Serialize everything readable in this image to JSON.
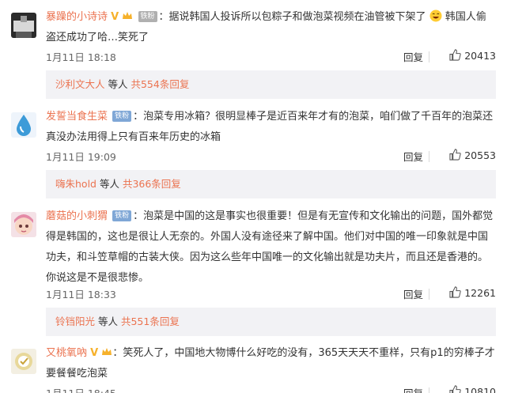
{
  "comments": [
    {
      "username": "暴躁的小诗诗",
      "vmark": "V",
      "fan_badge": "铁粉",
      "text_a": "：据说韩国人投诉所以包粽子和做泡菜视频在油管被下架了",
      "text_b": "韩国人偷盗还成功了哈…笑死了",
      "time": "1月11日 18:18",
      "reply_label": "回复",
      "likes": "20413",
      "sub": {
        "nick": "沙利文大人",
        "mid": " 等人 ",
        "count": "共554条回复"
      }
    },
    {
      "username": "发誓当食生菜",
      "fan_badge": "铁粉",
      "text_a": "：泡菜专用冰箱？很明显棒子是近百来年才有的泡菜，咱们做了千百年的泡菜还真没办法用得上只有百来年历史的冰箱",
      "time": "1月11日 19:09",
      "reply_label": "回复",
      "likes": "20553",
      "sub": {
        "nick": "嗨朱hold",
        "mid": " 等人 ",
        "count": "共366条回复"
      }
    },
    {
      "username": "蘑菇的小刺猬",
      "fan_badge": "铁粉",
      "text_a": "：泡菜是中国的这是事实也很重要！但是有无宣传和文化输出的问题，国外都觉得是韩国的，这也是很让人无奈的。外国人没有途径来了解中国。他们对中国的唯一印象就是中国功夫，和斗笠草帽的古装大侠。因为这么些年中国唯一的文化输出就是功夫片，而且还是香港的。你说这是不是很悲惨。",
      "time": "1月11日 18:33",
      "reply_label": "回复",
      "likes": "12261",
      "sub": {
        "nick": "铃铛阳光",
        "mid": " 等人 ",
        "count": "共551条回复"
      }
    },
    {
      "username": "又桃氧吶",
      "vmark": "V",
      "text_a": "：笑死人了，中国地大物博什么好吃的没有，365天天天不重样，只有p1的穷棒子才要餐餐吃泡菜",
      "time": "1月11日 18:45",
      "reply_label": "回复",
      "likes": "10810"
    }
  ],
  "icons": {
    "thumb": "thumbs-up-icon",
    "crown": "crown-icon",
    "emoji": "laughing-emoji-icon"
  },
  "colors": {
    "username": "#eb7350",
    "subreply_bg": "#f2f2f5",
    "fan_badge_blue": "#7fa7d6"
  }
}
